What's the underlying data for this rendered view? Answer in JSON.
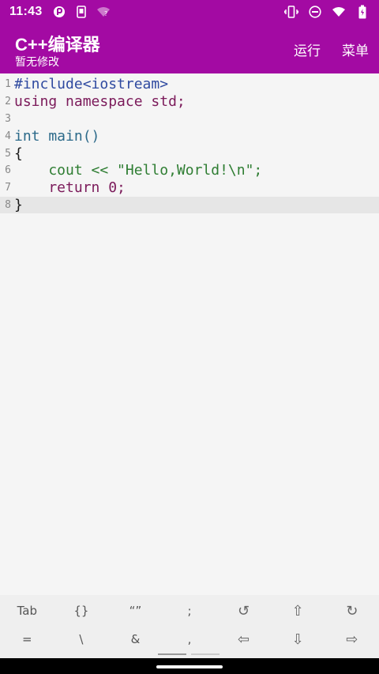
{
  "status_bar": {
    "time": "11:43",
    "icons_left": [
      "app-notification-icon",
      "phone-screen-icon",
      "wifi-question-icon"
    ],
    "icons_right": [
      "vibrate-icon",
      "do-not-disturb-icon",
      "wifi-signal-icon",
      "battery-icon"
    ]
  },
  "app_bar": {
    "title": "C++编译器",
    "subtitle": "暂无修改",
    "run_label": "运行",
    "menu_label": "菜单",
    "color": "#a30aa3"
  },
  "editor": {
    "lines": [
      {
        "num": "1",
        "text": "#include<iostream>"
      },
      {
        "num": "2",
        "text": "using namespace std;"
      },
      {
        "num": "3",
        "text": ""
      },
      {
        "num": "4",
        "text": "int main()"
      },
      {
        "num": "5",
        "text": "{"
      },
      {
        "num": "6",
        "text": "    cout << \"Hello,World!\\n\";"
      },
      {
        "num": "7",
        "text": "    return 0;"
      },
      {
        "num": "8",
        "text": "}"
      }
    ],
    "current_line": 8
  },
  "symbol_bar": {
    "row1": [
      "Tab",
      "{}",
      "“”",
      ";",
      "↺",
      "⇧",
      "↻"
    ],
    "row2": [
      "=",
      "\\",
      "&",
      ",",
      "⇦",
      "⇩",
      "⇨"
    ]
  }
}
